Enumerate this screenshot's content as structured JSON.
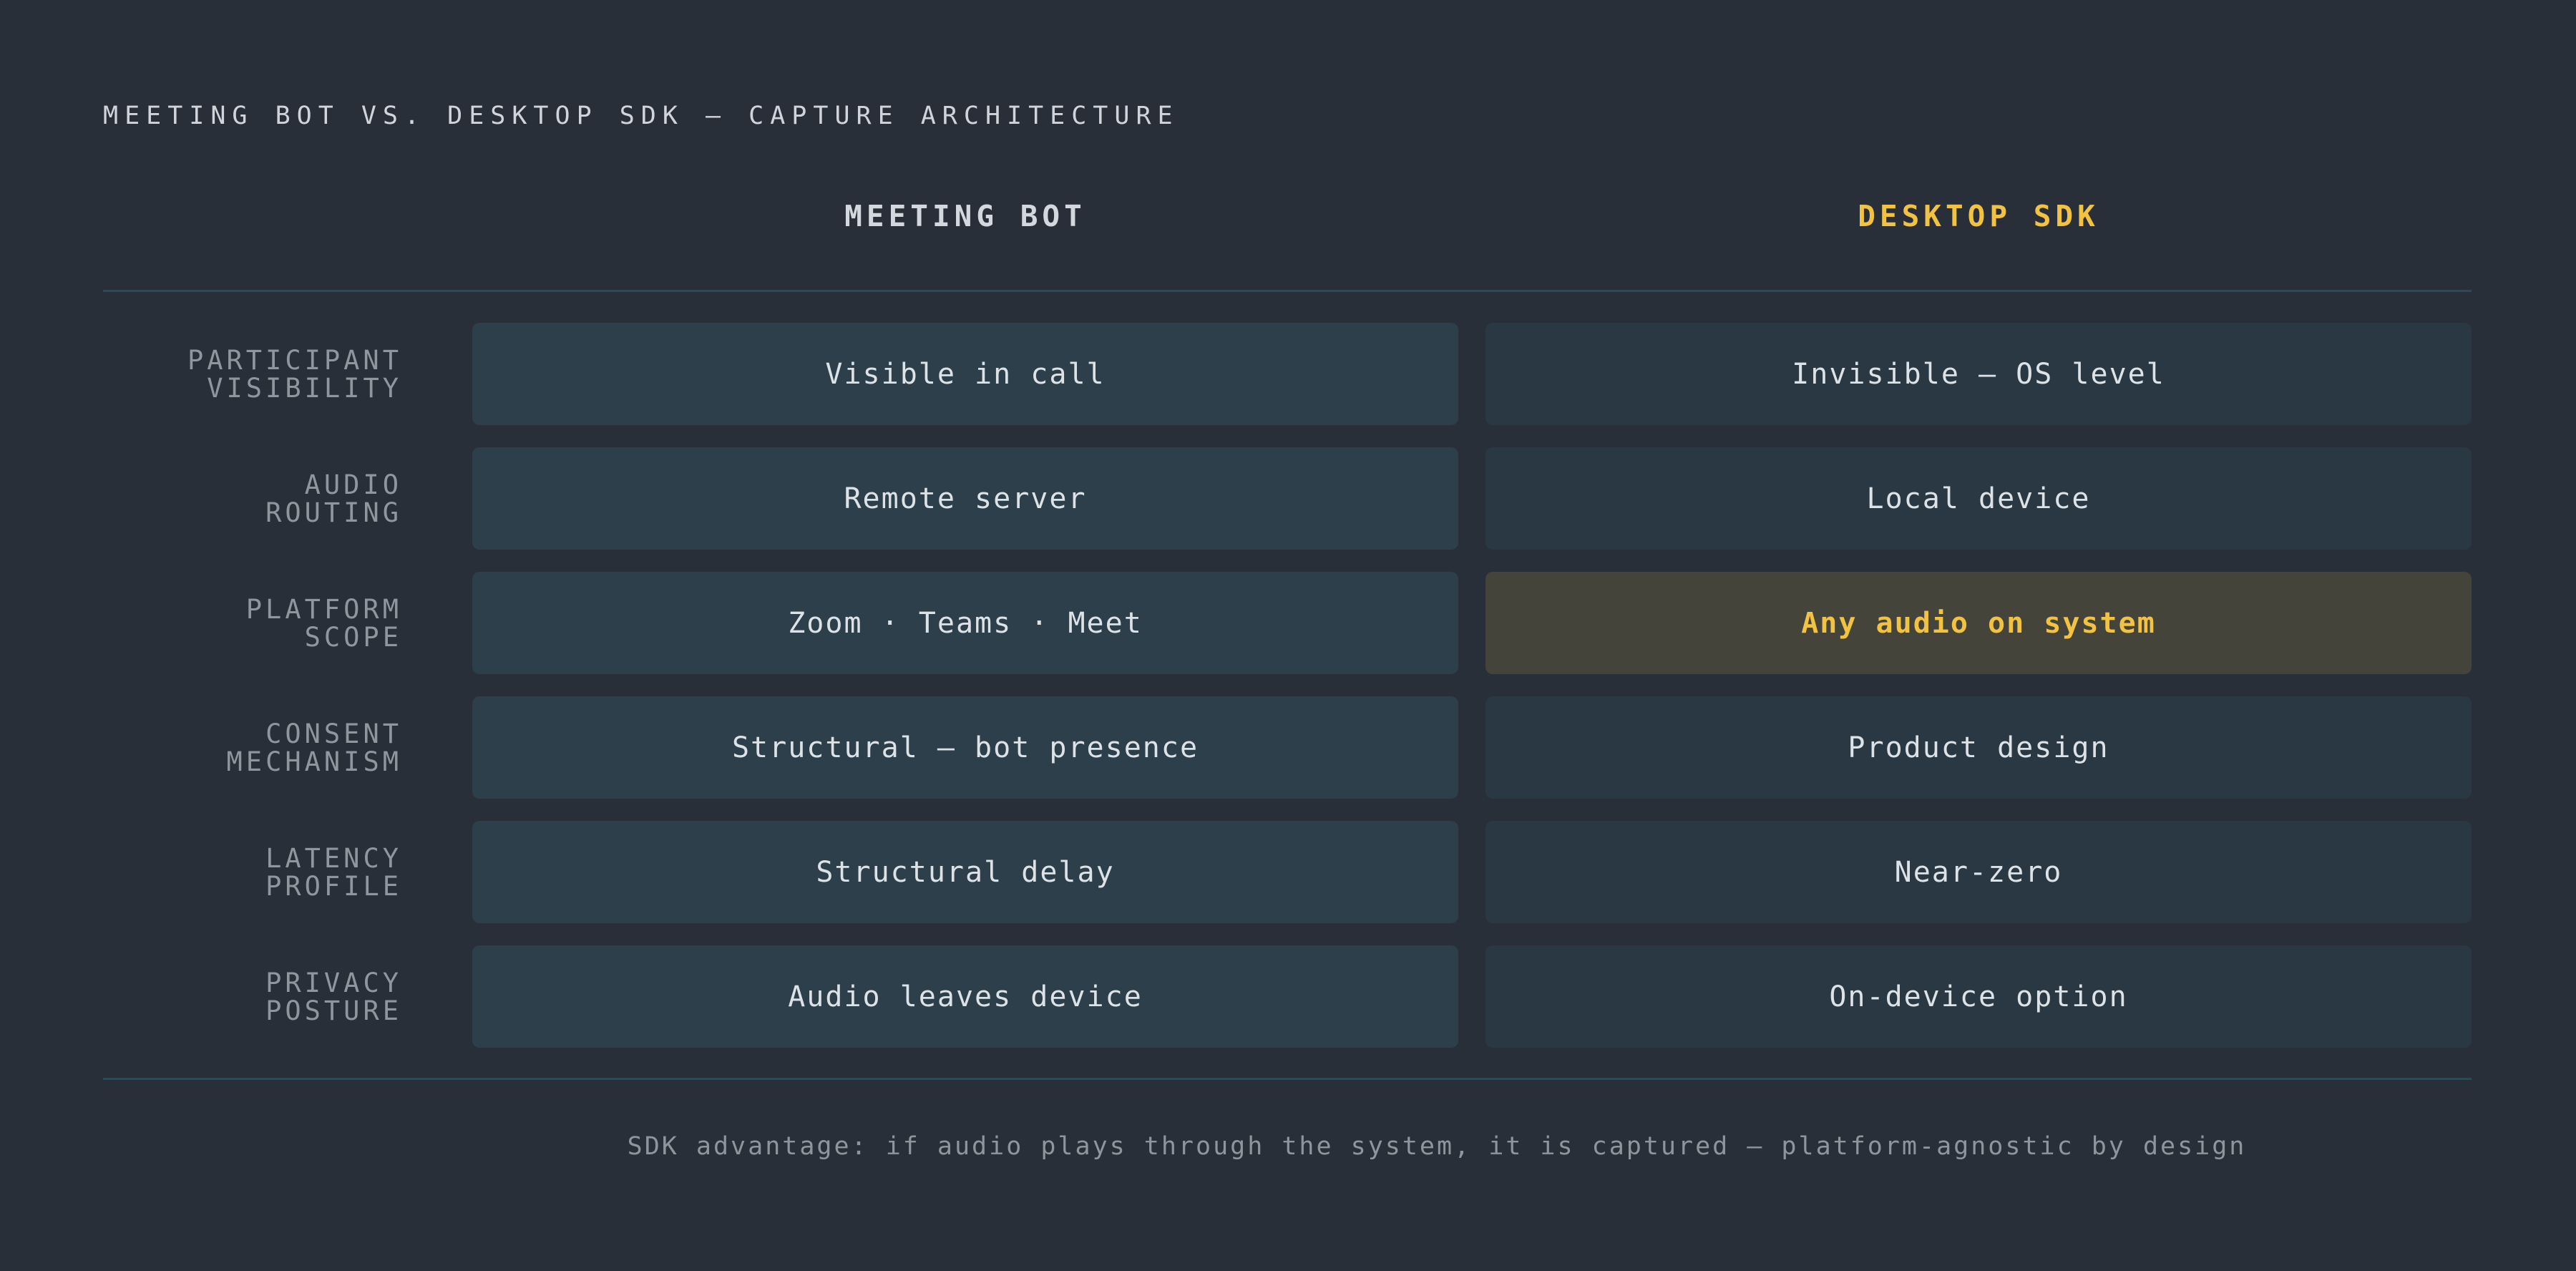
{
  "title": "MEETING BOT VS. DESKTOP SDK — CAPTURE ARCHITECTURE",
  "columns": {
    "bot": "MEETING BOT",
    "sdk": "DESKTOP SDK"
  },
  "accent_color": "#f2c243",
  "rows": [
    {
      "label_line1": "PARTICIPANT",
      "label_line2": "VISIBILITY",
      "bot": "Visible in call",
      "sdk": "Invisible — OS level",
      "highlight": false
    },
    {
      "label_line1": "AUDIO",
      "label_line2": "ROUTING",
      "bot": "Remote server",
      "sdk": "Local device",
      "highlight": false
    },
    {
      "label_line1": "PLATFORM",
      "label_line2": "SCOPE",
      "bot": "Zoom · Teams · Meet",
      "sdk": "Any audio on system",
      "highlight": true
    },
    {
      "label_line1": "CONSENT",
      "label_line2": "MECHANISM",
      "bot": "Structural — bot presence",
      "sdk": "Product design",
      "highlight": false
    },
    {
      "label_line1": "LATENCY",
      "label_line2": "PROFILE",
      "bot": "Structural delay",
      "sdk": "Near-zero",
      "highlight": false
    },
    {
      "label_line1": "PRIVACY",
      "label_line2": "POSTURE",
      "bot": "Audio leaves device",
      "sdk": "On-device option",
      "highlight": false
    }
  ],
  "footnote": "SDK advantage: if audio plays through the system, it is captured — platform-agnostic by design"
}
